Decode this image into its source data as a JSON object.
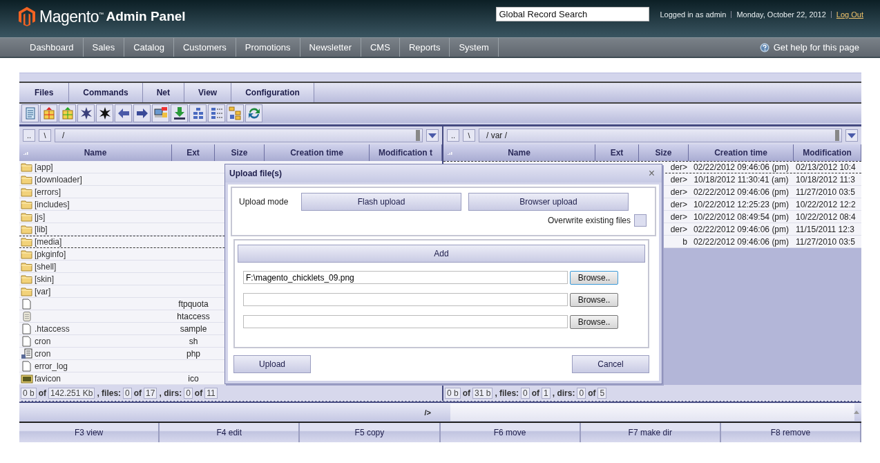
{
  "header": {
    "logo": "Magento$^{™}$",
    "logo_suffix": "Admin Panel",
    "search": {
      "value": "Global Record Search"
    },
    "user": "Logged in as admin",
    "date": "Monday, October 22, 2012",
    "logout": "Log Out"
  },
  "nav": [
    "Dashboard",
    "Sales",
    "Catalog",
    "Customers",
    "Promotions",
    "Newsletter",
    "CMS",
    "Reports",
    "System"
  ],
  "help": "Get help for this page",
  "menu_tabs": [
    "Files",
    "Commands",
    "Net",
    "View",
    "Configuration"
  ],
  "panes": [
    {
      "up": "..",
      "root": "\\",
      "path": "/",
      "columns": [
        "Name",
        "Ext",
        "Size",
        "Creation time",
        "Modification t"
      ],
      "rows": [
        {
          "kind": "folder",
          "name": "[app]",
          "focused": false
        },
        {
          "kind": "folder",
          "name": "[downloader]",
          "focused": false
        },
        {
          "kind": "folder",
          "name": "[errors]",
          "focused": false
        },
        {
          "kind": "folder",
          "name": "[includes]",
          "focused": false
        },
        {
          "kind": "folder",
          "name": "[js]",
          "focused": false
        },
        {
          "kind": "folder",
          "name": "[lib]",
          "focused": false
        },
        {
          "kind": "folder",
          "name": "[media]",
          "focused": true
        },
        {
          "kind": "folder",
          "name": "[pkginfo]",
          "focused": false
        },
        {
          "kind": "folder",
          "name": "[shell]",
          "focused": false
        },
        {
          "kind": "folder",
          "name": "[skin]",
          "focused": false
        },
        {
          "kind": "folder",
          "name": "[var]",
          "focused": false
        },
        {
          "kind": "file",
          "ext": "ftpquota",
          "focused": false
        },
        {
          "kind": "notes",
          "ext": "htaccess",
          "focused": false
        },
        {
          "kind": "file",
          "name": ".htaccess",
          "ext": "sample",
          "focused": false
        },
        {
          "kind": "file",
          "name": "cron",
          "ext": "sh",
          "focused": false
        },
        {
          "kind": "script",
          "name": "cron",
          "ext": "php",
          "focused": false
        },
        {
          "kind": "file",
          "name": "error_log",
          "focused": false
        },
        {
          "kind": "image",
          "name": "favicon",
          "ext": "ico",
          "focused": false
        }
      ],
      "status": [
        {
          "kind": "box",
          "text": "0 b"
        },
        {
          "kind": "text",
          "text": "of"
        },
        {
          "kind": "box",
          "text": "142.251 Kb"
        },
        {
          "kind": "text",
          "text": ", files:"
        },
        {
          "kind": "box",
          "text": "0"
        },
        {
          "kind": "text",
          "text": "of"
        },
        {
          "kind": "box",
          "text": "17"
        },
        {
          "kind": "text",
          "text": ", dirs:"
        },
        {
          "kind": "box",
          "text": "0"
        },
        {
          "kind": "text",
          "text": "of"
        },
        {
          "kind": "box",
          "text": "11"
        }
      ]
    },
    {
      "up": "..",
      "root": "\\",
      "path": "/ var /",
      "columns": [
        "Name",
        "Ext",
        "Size",
        "Creation time",
        "Modification"
      ],
      "rows": [
        {
          "size": "der>",
          "created": "02/22/2012 09:46:06 (pm)",
          "modified": "02/13/2012 10:4",
          "focused": true
        },
        {
          "size": "der>",
          "created": "10/18/2012 11:30:41 (am)",
          "modified": "10/18/2012 11:3",
          "focused": false
        },
        {
          "size": "der>",
          "created": "02/22/2012 09:46:06 (pm)",
          "modified": "11/27/2010 03:5",
          "focused": false
        },
        {
          "size": "der>",
          "created": "10/22/2012 12:25:23 (pm)",
          "modified": "10/22/2012 12:2",
          "focused": false
        },
        {
          "size": "der>",
          "created": "10/22/2012 08:49:54 (pm)",
          "modified": "10/22/2012 08:4",
          "focused": false
        },
        {
          "size": "der>",
          "created": "02/22/2012 09:46:06 (pm)",
          "modified": "11/15/2011 12:3",
          "focused": false
        },
        {
          "size": "b",
          "created": "02/22/2012 09:46:06 (pm)",
          "modified": "11/27/2010 03:5",
          "focused": false
        }
      ],
      "status": [
        {
          "kind": "box",
          "text": "0 b"
        },
        {
          "kind": "text",
          "text": "of"
        },
        {
          "kind": "box",
          "text": "31 b"
        },
        {
          "kind": "text",
          "text": ", files:"
        },
        {
          "kind": "box",
          "text": "0"
        },
        {
          "kind": "text",
          "text": "of"
        },
        {
          "kind": "box",
          "text": "1"
        },
        {
          "kind": "text",
          "text": ", dirs:"
        },
        {
          "kind": "box",
          "text": "0"
        },
        {
          "kind": "text",
          "text": "of"
        },
        {
          "kind": "box",
          "text": "5"
        }
      ]
    }
  ],
  "command_prompt": "/>",
  "function_keys": [
    "F3 view",
    "F4 edit",
    "F5 copy",
    "F6 move",
    "F7 make dir",
    "F8 remove"
  ],
  "dialog": {
    "title": "Upload file(s)",
    "close": "×",
    "mode_label": "Upload mode",
    "modes": [
      "Flash upload",
      "Browser upload"
    ],
    "overwrite": {
      "label": "Overwrite existing files",
      "checked": false
    },
    "add": "Add",
    "files": [
      {
        "value": "F:\\magento_chicklets_09.png",
        "browse": "Browse..",
        "focused": true
      },
      {
        "browse": "Browse..",
        "focused": false
      },
      {
        "browse": "Browse..",
        "focused": false
      }
    ],
    "upload": "Upload",
    "cancel": "Cancel"
  }
}
